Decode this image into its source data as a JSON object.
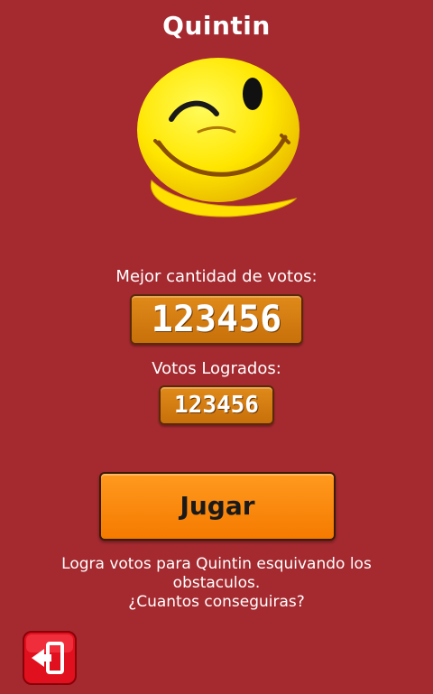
{
  "header": {
    "title": "Quintin"
  },
  "scores": {
    "best_label": "Mejor cantidad de votos:",
    "best_value": "123456",
    "got_label": "Votos Logrados:",
    "got_value": "123456"
  },
  "actions": {
    "play_label": "Jugar"
  },
  "description": {
    "line1": "Logra votos para Quintin esquivando los",
    "line2": "obstaculos.",
    "line3": "¿Cuantos conseguiras?"
  },
  "icons": {
    "logo": "winking-smiley-q-icon",
    "exit": "exit-door-icon"
  },
  "colors": {
    "background": "#a52a30",
    "accent": "#f57a00",
    "score_box": "#d07a10",
    "exit_button": "#e0101e"
  }
}
